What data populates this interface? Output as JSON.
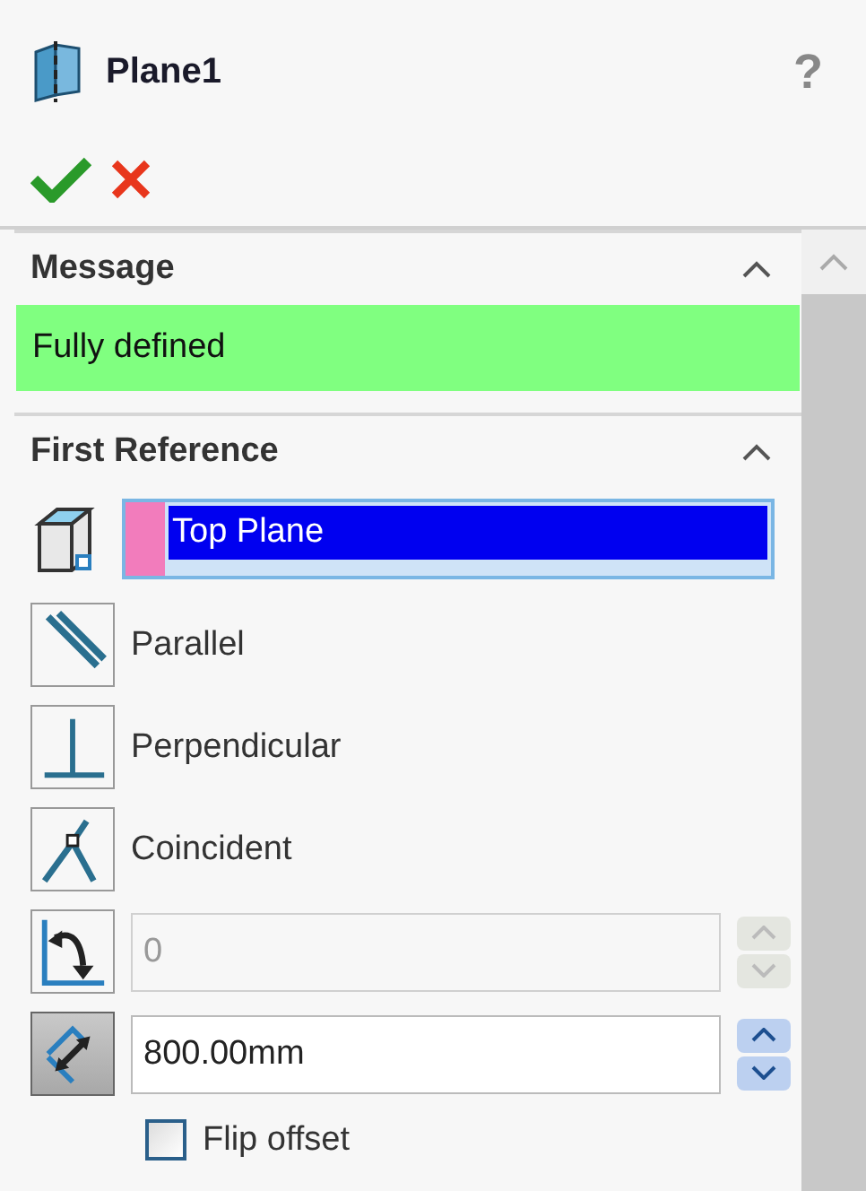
{
  "window": {
    "title": "Plane1",
    "help": "?"
  },
  "actions": [
    {
      "kind": "ok"
    },
    {
      "kind": "cancel"
    }
  ],
  "message": {
    "title": "Message",
    "expanded": true,
    "text": "Fully defined",
    "color": "#80ff80"
  },
  "first_reference": {
    "title": "First Reference",
    "expanded": true,
    "selection": "Top Plane",
    "constraints": [
      {
        "kind": "parallel",
        "label": "Parallel",
        "selected": false
      },
      {
        "kind": "perpendicular",
        "label": "Perpendicular",
        "selected": false
      },
      {
        "kind": "coincident",
        "label": "Coincident",
        "selected": false
      }
    ],
    "angle": {
      "value": "0",
      "selected": false,
      "disabled": true
    },
    "distance": {
      "value": "800.00mm",
      "selected": true,
      "disabled": false
    },
    "flip_offset": {
      "label": "Flip offset",
      "checked": false
    }
  }
}
